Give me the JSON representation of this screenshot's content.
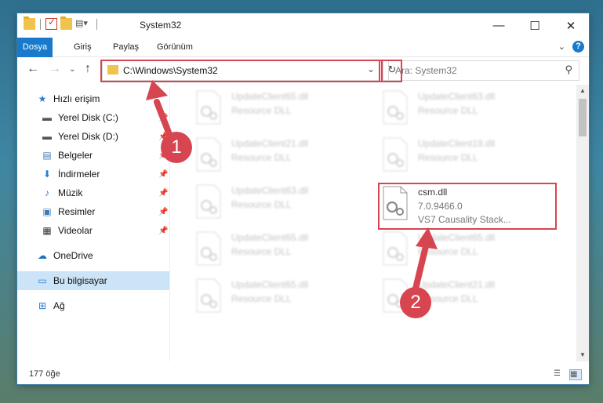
{
  "window": {
    "title": "System32",
    "controls": {
      "minimize": "—",
      "maximize": "☐",
      "close": "✕"
    }
  },
  "ribbon": {
    "tabs": [
      "Dosya",
      "Giriş",
      "Paylaş",
      "Görünüm"
    ],
    "help": "?"
  },
  "address_bar": {
    "path": "C:\\Windows\\System32",
    "search_placeholder": "Ara: System32"
  },
  "sidebar": {
    "items": [
      {
        "label": "Hızlı erişim",
        "icon": "star-icon"
      },
      {
        "label": "Yerel Disk (C:)",
        "icon": "drive-icon",
        "pinned": true
      },
      {
        "label": "Yerel Disk (D:)",
        "icon": "drive-icon",
        "pinned": true
      },
      {
        "label": "Belgeler",
        "icon": "document-icon",
        "pinned": true
      },
      {
        "label": "İndirmeler",
        "icon": "download-icon",
        "pinned": true
      },
      {
        "label": "Müzik",
        "icon": "music-icon",
        "pinned": true
      },
      {
        "label": "Resimler",
        "icon": "pictures-icon",
        "pinned": true
      },
      {
        "label": "Videolar",
        "icon": "video-icon",
        "pinned": true
      },
      {
        "label": "OneDrive",
        "icon": "cloud-icon"
      },
      {
        "label": "Bu bilgisayar",
        "icon": "computer-icon",
        "selected": true
      },
      {
        "label": "Ağ",
        "icon": "network-icon"
      }
    ]
  },
  "files": [
    {
      "name": "UpdateClient65.dll",
      "desc": "Resource DLL",
      "blurred": true
    },
    {
      "name": "UpdateClient63.dll",
      "desc": "Resource DLL",
      "blurred": true
    },
    {
      "name": "UpdateClient21.dll",
      "desc": "Resource DLL",
      "blurred": true
    },
    {
      "name": "UpdateClient19.dll",
      "desc": "Resource DLL",
      "blurred": true
    },
    {
      "name": "UpdateClient63.dll",
      "desc": "Resource DLL",
      "blurred": true
    },
    {
      "name": "csm.dll",
      "version": "7.0.9466.0",
      "desc": "VS7 Causality Stack...",
      "blurred": false
    },
    {
      "name": "UpdateClient65.dll",
      "desc": "Resource DLL",
      "blurred": true
    },
    {
      "name": "UpdateClient65.dll",
      "desc": "Resource DLL",
      "blurred": true
    },
    {
      "name": "UpdateClient65.dll",
      "desc": "Resource DLL",
      "blurred": true
    },
    {
      "name": "UpdateClient21.dll",
      "desc": "Resource DLL",
      "blurred": true
    }
  ],
  "status_bar": {
    "item_count": "177 öğe"
  },
  "annotations": {
    "badge1": "1",
    "badge2": "2",
    "color": "#d64550"
  }
}
